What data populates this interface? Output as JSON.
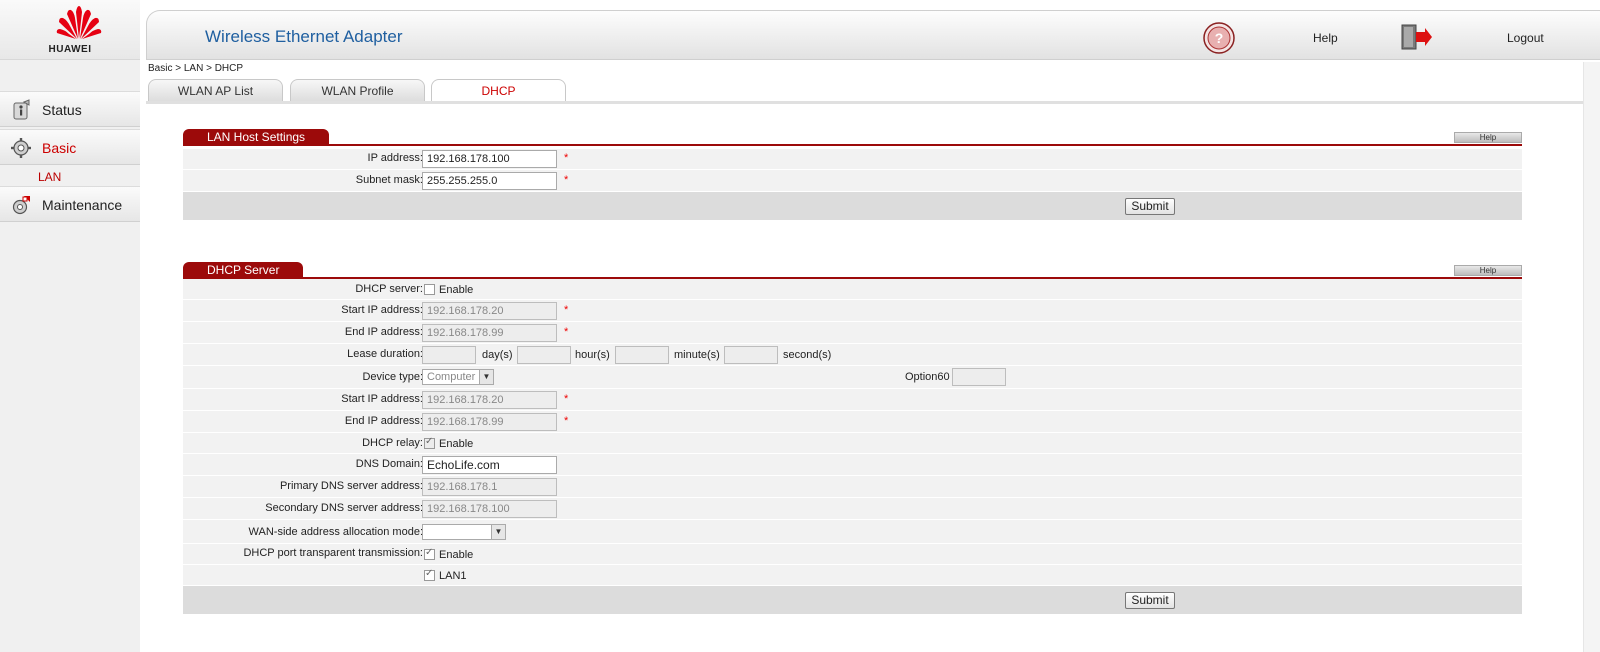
{
  "brand": {
    "logo_text": "HUAWEI",
    "logo_color": "#e60012"
  },
  "header": {
    "title": "Wireless Ethernet Adapter",
    "help_label": "Help",
    "logout_label": "Logout",
    "help_icon": "question-icon",
    "logout_icon": "logout-door-icon"
  },
  "sidebar": {
    "items": [
      {
        "label": "Status",
        "icon": "status-info-icon"
      },
      {
        "label": "Basic",
        "icon": "settings-gear-icon"
      },
      {
        "label": "Maintenance",
        "icon": "maintenance-tools-icon"
      }
    ],
    "submenu": {
      "label": "LAN"
    }
  },
  "breadcrumb": "Basic > LAN > DHCP",
  "tabs": [
    {
      "label": "WLAN AP List"
    },
    {
      "label": "WLAN Profile"
    },
    {
      "label": "DHCP",
      "active": true
    }
  ],
  "lan_host": {
    "title": "LAN Host Settings",
    "help": "Help",
    "ip_label": "IP address:",
    "ip_value": "192.168.178.100",
    "mask_label": "Subnet mask:",
    "mask_value": "255.255.255.0",
    "required_mark": "*",
    "submit": "Submit"
  },
  "dhcp_server": {
    "title": "DHCP Server",
    "help": "Help",
    "server_label": "DHCP server:",
    "server_enable": "Enable",
    "server_checked": false,
    "start_label": "Start IP address:",
    "start_value": "192.168.178.20",
    "end_label": "End IP address:",
    "end_value": "192.168.178.99",
    "lease_label": "Lease duration:",
    "day_unit": "day(s)",
    "hour_unit": "hour(s)",
    "minute_unit": "minute(s)",
    "second_unit": "second(s)",
    "device_label": "Device type:",
    "device_value": "Computer",
    "option60_label": "Option60",
    "start2_label": "Start IP address:",
    "start2_value": "192.168.178.20",
    "end2_label": "End IP address:",
    "end2_value": "192.168.178.99",
    "relay_label": "DHCP relay:",
    "relay_enable": "Enable",
    "relay_checked": true,
    "dns_domain_label": "DNS Domain:",
    "dns_domain_value": "EchoLife.com",
    "primary_dns_label": "Primary DNS server address:",
    "primary_dns_value": "192.168.178.1",
    "secondary_dns_label": "Secondary DNS server address:",
    "secondary_dns_value": "192.168.178.100",
    "wan_mode_label": "WAN-side address allocation mode:",
    "wan_mode_value": "",
    "port_trans_label": "DHCP port transparent transmission:",
    "port_trans_enable": "Enable",
    "port_trans_checked": true,
    "lan1_label": "LAN1",
    "lan1_checked": true,
    "required_mark": "*",
    "submit": "Submit"
  }
}
